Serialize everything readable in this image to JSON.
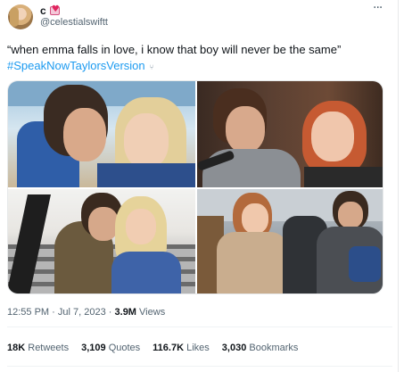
{
  "author": {
    "display_name": "c",
    "badge_icon": "heart-letter-icon",
    "handle": "@celestialswiftt"
  },
  "tweet": {
    "text": "“when emma falls in love, i know that boy will never be the same”",
    "hashtag": "#SpeakNowTaylorsVersion",
    "hashtag_color": "#1d9bf0"
  },
  "media": {
    "photo_count": 4
  },
  "meta": {
    "time": "12:55 PM",
    "separator": "·",
    "date": "Jul 7, 2023",
    "views_count": "3.9M",
    "views_label": "Views"
  },
  "engagements": {
    "retweets_count": "18K",
    "retweets_label": "Retweets",
    "quotes_count": "3,109",
    "quotes_label": "Quotes",
    "likes_count": "116.7K",
    "likes_label": "Likes",
    "bookmarks_count": "3,030",
    "bookmarks_label": "Bookmarks"
  },
  "colors": {
    "text_primary": "#0f1419",
    "text_secondary": "#536471",
    "accent": "#1d9bf0"
  }
}
